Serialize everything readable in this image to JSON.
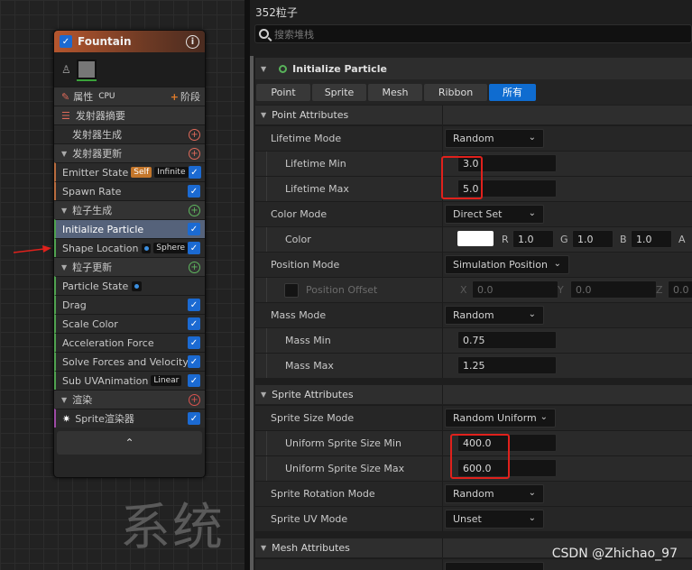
{
  "graph": {
    "watermark": "系统"
  },
  "node": {
    "title": "Fountain",
    "rows": {
      "props": {
        "label": "属性",
        "cpu": "CPU",
        "stage": "阶段"
      },
      "summary": "发射器摘要",
      "emitter_spawn": "发射器生成",
      "emitter_update": "发射器更新",
      "emitter_state": {
        "label": "Emitter State",
        "tag1": "Self",
        "tag2": "Infinite"
      },
      "spawn_rate": "Spawn Rate",
      "particle_spawn": "粒子生成",
      "initialize_particle": "Initialize Particle",
      "shape_location": {
        "label": "Shape Location",
        "tag": "Sphere"
      },
      "particle_update": "粒子更新",
      "particle_state": "Particle State",
      "drag": "Drag",
      "scale_color": "Scale Color",
      "acceleration_force": "Acceleration Force",
      "solve_forces": "Solve Forces and Velocity",
      "sub_uv": {
        "label": "Sub UVAnimation",
        "tag": "Linear"
      },
      "render": "渲染",
      "sprite_renderer": "Sprite渲染器"
    }
  },
  "panel": {
    "title": "352粒子",
    "search_placeholder": "搜索堆栈",
    "section_title": "Initialize Particle",
    "tabs": [
      "Point",
      "Sprite",
      "Mesh",
      "Ribbon",
      "所有"
    ],
    "point_attributes": {
      "header": "Point Attributes",
      "lifetime_mode": {
        "label": "Lifetime Mode",
        "value": "Random"
      },
      "lifetime_min": {
        "label": "Lifetime Min",
        "value": "3.0"
      },
      "lifetime_max": {
        "label": "Lifetime Max",
        "value": "5.0"
      },
      "color_mode": {
        "label": "Color Mode",
        "value": "Direct Set"
      },
      "color": {
        "label": "Color",
        "r_label": "R",
        "r": "1.0",
        "g_label": "G",
        "g": "1.0",
        "b_label": "B",
        "b": "1.0",
        "a_label": "A"
      },
      "position_mode": {
        "label": "Position Mode",
        "value": "Simulation Position"
      },
      "position_offset": {
        "label": "Position Offset",
        "x_label": "X",
        "x": "0.0",
        "y_label": "Y",
        "y": "0.0",
        "z_label": "Z",
        "z": "0.0"
      },
      "mass_mode": {
        "label": "Mass Mode",
        "value": "Random"
      },
      "mass_min": {
        "label": "Mass Min",
        "value": "0.75"
      },
      "mass_max": {
        "label": "Mass Max",
        "value": "1.25"
      }
    },
    "sprite_attributes": {
      "header": "Sprite Attributes",
      "size_mode": {
        "label": "Sprite Size Mode",
        "value": "Random Uniform"
      },
      "size_min": {
        "label": "Uniform Sprite Size Min",
        "value": "400.0"
      },
      "size_max": {
        "label": "Uniform Sprite Size Max",
        "value": "600.0"
      },
      "rotation_mode": {
        "label": "Sprite Rotation Mode",
        "value": "Random"
      },
      "uv_mode": {
        "label": "Sprite UV Mode",
        "value": "Unset"
      }
    },
    "mesh_attributes": {
      "header": "Mesh Attributes"
    }
  },
  "watermark": "CSDN @Zhichao_97",
  "colors": {
    "accent": "#0f6cd0",
    "highlight_box": "#e0211c",
    "emitter_header": "#b5562e"
  }
}
